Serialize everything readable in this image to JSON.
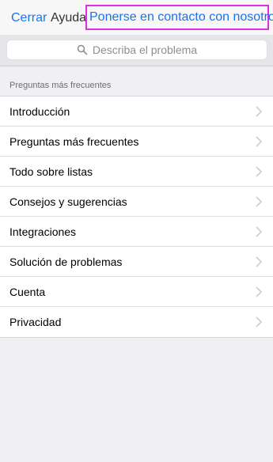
{
  "nav": {
    "close_label": "Cerrar",
    "title": "Ayuda",
    "contact_label": "Ponerse en contacto con nosotros"
  },
  "search": {
    "placeholder": "Describa el problema"
  },
  "section": {
    "header": "Preguntas más frecuentes"
  },
  "items": [
    {
      "label": "Introducción"
    },
    {
      "label": "Preguntas más frecuentes"
    },
    {
      "label": "Todo sobre listas"
    },
    {
      "label": "Consejos y sugerencias"
    },
    {
      "label": "Integraciones"
    },
    {
      "label": "Solución de problemas"
    },
    {
      "label": "Cuenta"
    },
    {
      "label": "Privacidad"
    }
  ],
  "colors": {
    "accent": "#1a73e8",
    "highlight_border": "#e02de0",
    "background": "#efeff4"
  },
  "icons": {
    "search": "search-icon",
    "chevron": "chevron-right-icon"
  }
}
